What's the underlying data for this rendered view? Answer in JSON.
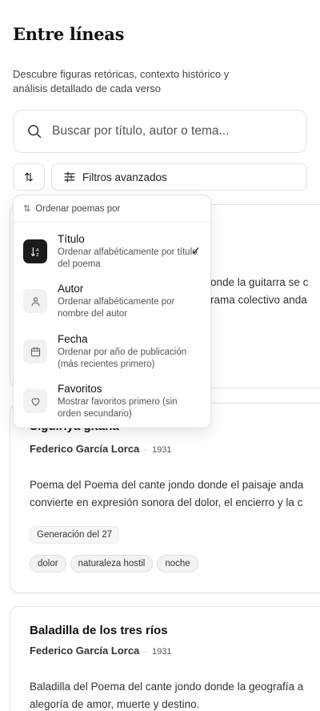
{
  "app": {
    "title": "Entre líneas",
    "subtitle": "Descubre figuras retóricas, contexto histórico y análisis detallado de cada verso"
  },
  "search": {
    "placeholder": "Buscar por título, autor o tema..."
  },
  "toolbar": {
    "sort_symbol": "⇅",
    "filters_label": "Filtros avanzados"
  },
  "sort_menu": {
    "header": "Ordenar poemas por",
    "options": [
      {
        "label": "Título",
        "description": "Ordenar alfabéticamente por título del poema",
        "icon": "sort-alpha-icon",
        "selected": true
      },
      {
        "label": "Autor",
        "description": "Ordenar alfabéticamente por nombre del autor",
        "icon": "user-icon",
        "selected": false
      },
      {
        "label": "Fecha",
        "description": "Ordenar por año de publicación (más recientes primero)",
        "icon": "calendar-icon",
        "selected": false
      },
      {
        "label": "Favoritos",
        "description": "Mostrar favoritos primero (sin orden secundario)",
        "icon": "heart-icon",
        "selected": false
      }
    ]
  },
  "poems": [
    {
      "description_visible": [
        "onde la guitarra se c",
        "rama colectivo anda"
      ]
    },
    {
      "title": "Siguiriya gitana",
      "author": "Federico García Lorca",
      "year": "1931",
      "description": [
        "Poema del Poema del cante jondo donde el paisaje anda",
        "convierte en expresión sonora del dolor, el encierro y la c"
      ],
      "badge": "Generación del 27",
      "tags": [
        "dolor",
        "naturaleza hostil",
        "noche"
      ]
    },
    {
      "title": "Baladilla de los tres ríos",
      "author": "Federico García Lorca",
      "year": "1931",
      "description": [
        "Baladilla del Poema del cante jondo donde la geografía a",
        "alegoría de amor, muerte y destino."
      ]
    }
  ],
  "colors": {
    "accent": "#1c1c1c",
    "border": "#e3e3e3",
    "background": "#ffffff"
  }
}
